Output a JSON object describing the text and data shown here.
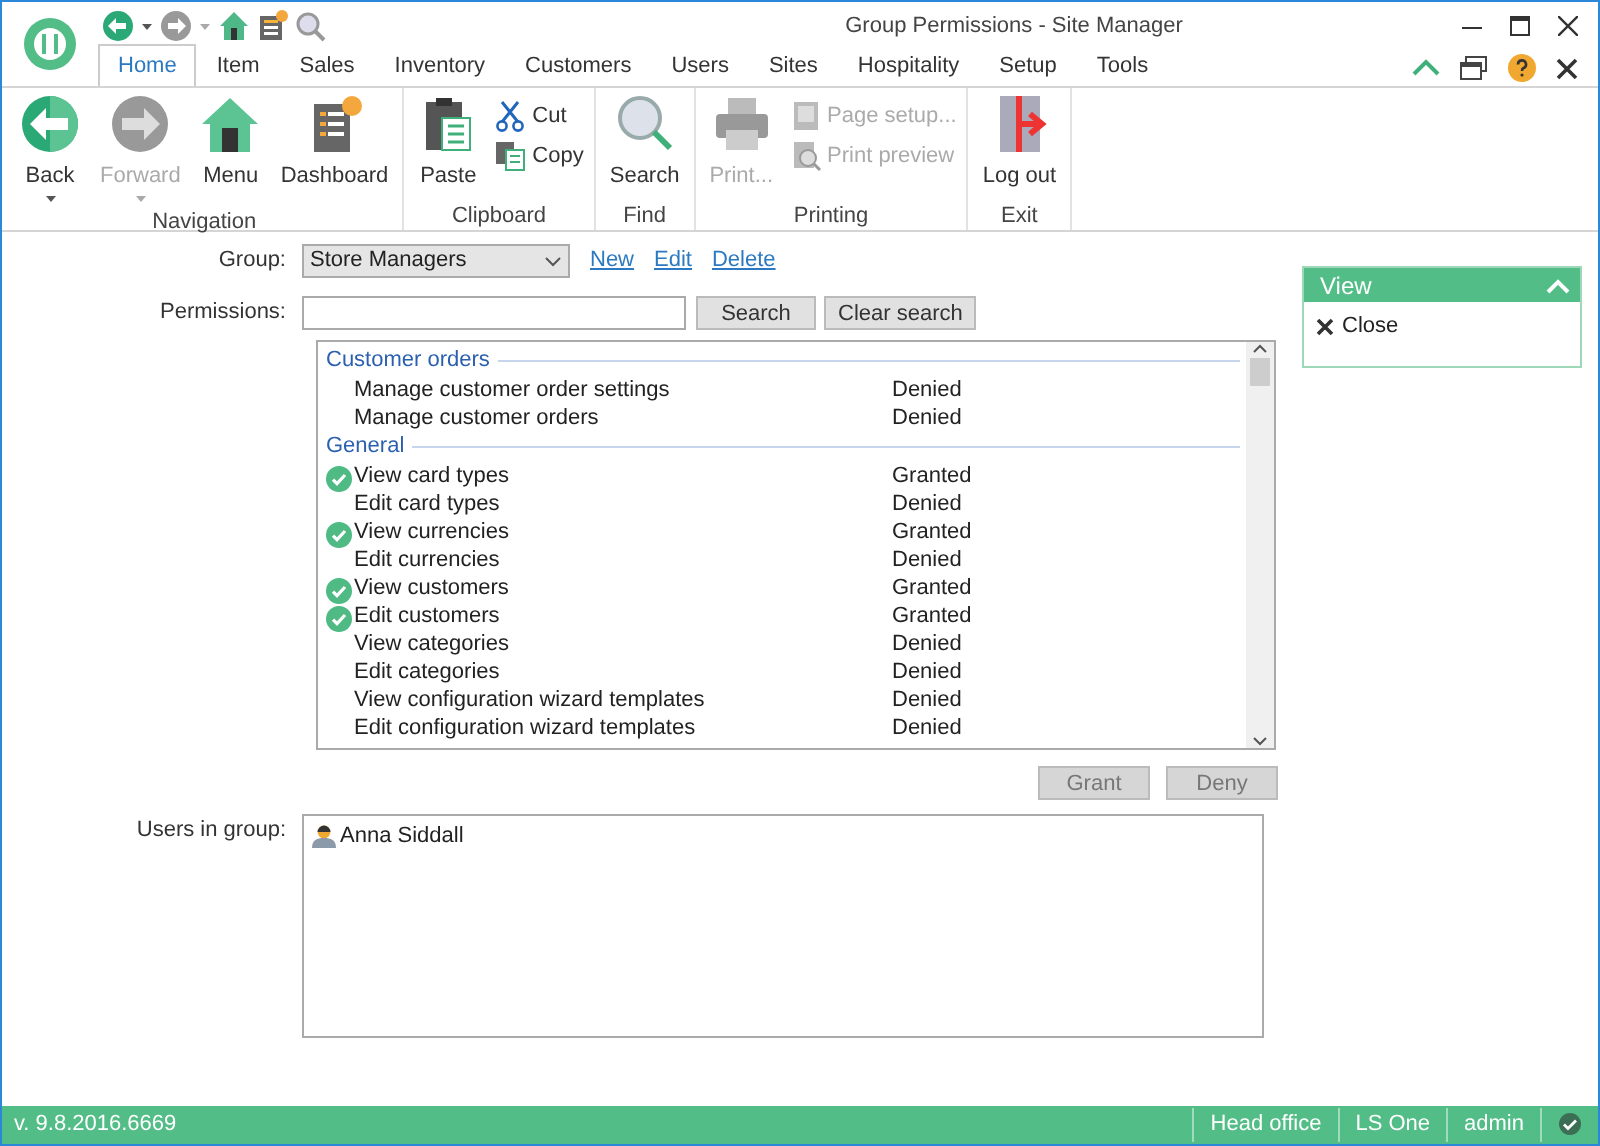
{
  "window": {
    "title": "Group Permissions - Site Manager"
  },
  "tabs": [
    {
      "label": "Home",
      "selected": true
    },
    {
      "label": "Item",
      "selected": false
    },
    {
      "label": "Sales",
      "selected": false
    },
    {
      "label": "Inventory",
      "selected": false
    },
    {
      "label": "Customers",
      "selected": false
    },
    {
      "label": "Users",
      "selected": false
    },
    {
      "label": "Sites",
      "selected": false
    },
    {
      "label": "Hospitality",
      "selected": false
    },
    {
      "label": "Setup",
      "selected": false
    },
    {
      "label": "Tools",
      "selected": false
    }
  ],
  "ribbon": [
    {
      "label": "Navigation",
      "items": [
        {
          "label": "Back",
          "kind": "large",
          "disabled": false,
          "dropdown": true
        },
        {
          "label": "Forward",
          "kind": "large",
          "disabled": true,
          "dropdown": true
        },
        {
          "label": "Menu",
          "kind": "large",
          "disabled": false,
          "dropdown": false
        },
        {
          "label": "Dashboard",
          "kind": "large",
          "disabled": false,
          "dropdown": false
        }
      ]
    },
    {
      "label": "Clipboard",
      "items": [
        {
          "label": "Paste",
          "kind": "large",
          "disabled": false,
          "dropdown": false
        },
        {
          "label": "Cut",
          "kind": "small",
          "disabled": false
        },
        {
          "label": "Copy",
          "kind": "small",
          "disabled": false
        }
      ]
    },
    {
      "label": "Find",
      "items": [
        {
          "label": "Search",
          "kind": "large",
          "disabled": false,
          "dropdown": false
        }
      ]
    },
    {
      "label": "Printing",
      "items": [
        {
          "label": "Print...",
          "kind": "large",
          "disabled": true,
          "dropdown": false
        },
        {
          "label": "Page setup...",
          "kind": "small",
          "disabled": true
        },
        {
          "label": "Print preview",
          "kind": "small",
          "disabled": true
        }
      ]
    },
    {
      "label": "Exit",
      "items": [
        {
          "label": "Log out",
          "kind": "large",
          "disabled": false,
          "dropdown": false
        }
      ]
    }
  ],
  "form": {
    "group_label": "Group:",
    "group_value": "Store Managers",
    "links": [
      "New",
      "Edit",
      "Delete"
    ],
    "permissions_label": "Permissions:",
    "search_button": "Search",
    "clear_button": "Clear search"
  },
  "permissions": [
    {
      "title": "Customer orders",
      "rows": [
        {
          "name": "Manage customer order settings",
          "status": "Denied",
          "granted": false
        },
        {
          "name": "Manage customer orders",
          "status": "Denied",
          "granted": false
        }
      ]
    },
    {
      "title": "General",
      "rows": [
        {
          "name": "View card types",
          "status": "Granted",
          "granted": true
        },
        {
          "name": "Edit card types",
          "status": "Denied",
          "granted": false
        },
        {
          "name": "View currencies",
          "status": "Granted",
          "granted": true
        },
        {
          "name": "Edit currencies",
          "status": "Denied",
          "granted": false
        },
        {
          "name": "View customers",
          "status": "Granted",
          "granted": true
        },
        {
          "name": "Edit customers",
          "status": "Granted",
          "granted": true
        },
        {
          "name": "View categories",
          "status": "Denied",
          "granted": false
        },
        {
          "name": "Edit categories",
          "status": "Denied",
          "granted": false
        },
        {
          "name": "View configuration wizard templates",
          "status": "Denied",
          "granted": false
        },
        {
          "name": "Edit configuration wizard templates",
          "status": "Denied",
          "granted": false
        }
      ]
    }
  ],
  "actions": [
    {
      "label": "Grant",
      "disabled": true
    },
    {
      "label": "Deny",
      "disabled": true
    }
  ],
  "users_label": "Users in group:",
  "users": [
    "Anna Siddall"
  ],
  "view_panel": {
    "title": "View",
    "items": [
      "Close"
    ]
  },
  "status_bar": {
    "version": "v. 9.8.2016.6669",
    "items": [
      "Head office",
      "LS One",
      "admin"
    ]
  }
}
